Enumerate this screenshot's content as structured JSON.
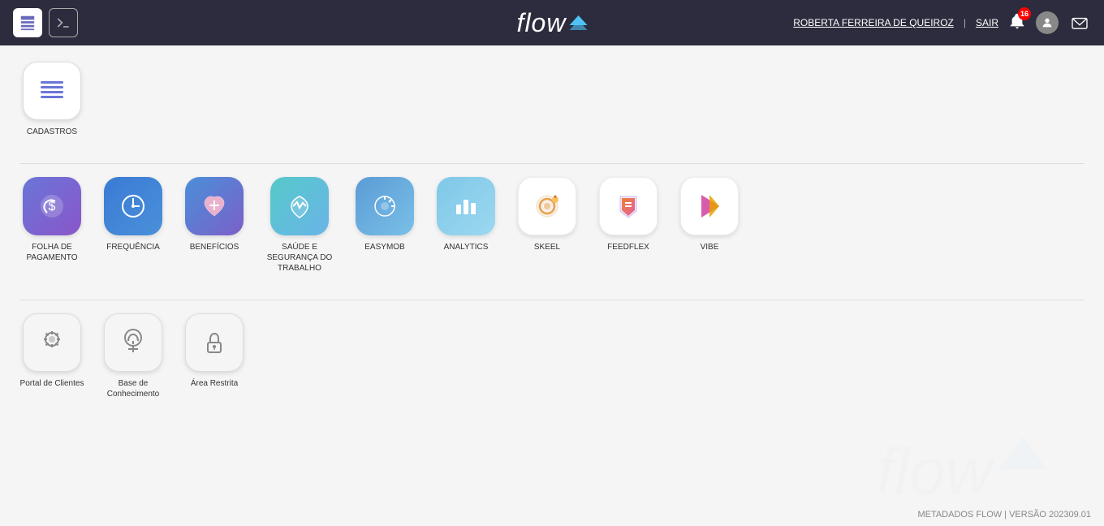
{
  "header": {
    "logo_text": "flow",
    "user_name": "ROBERTA FERREIRA DE QUEIROZ",
    "separator": "|",
    "sair_label": "SAIR",
    "bell_count": "16"
  },
  "sections": [
    {
      "id": "cadastros",
      "apps": [
        {
          "id": "cadastros",
          "label": "CADASTROS",
          "icon_type": "cadastros"
        }
      ]
    },
    {
      "id": "main-apps",
      "apps": [
        {
          "id": "folha",
          "label": "FOLHA DE PAGAMENTO",
          "icon_type": "folha"
        },
        {
          "id": "frequencia",
          "label": "FREQUÊNCIA",
          "icon_type": "frequencia"
        },
        {
          "id": "beneficios",
          "label": "BENEFÍCIOS",
          "icon_type": "beneficios"
        },
        {
          "id": "saude",
          "label": "SAÚDE E SEGURANÇA DO TRABALHO",
          "icon_type": "saude"
        },
        {
          "id": "easymob",
          "label": "EASYMOB",
          "icon_type": "easymob"
        },
        {
          "id": "analytics",
          "label": "ANALYTICS",
          "icon_type": "analytics"
        },
        {
          "id": "skeel",
          "label": "SKEEL",
          "icon_type": "skeel"
        },
        {
          "id": "feedflex",
          "label": "FEEDFLEX",
          "icon_type": "feedflex"
        },
        {
          "id": "vibe",
          "label": "VIBE",
          "icon_type": "vibe"
        }
      ]
    },
    {
      "id": "other-apps",
      "apps": [
        {
          "id": "portal",
          "label": "Portal de Clientes",
          "icon_type": "portal"
        },
        {
          "id": "base",
          "label": "Base de Conhecimento",
          "icon_type": "base"
        },
        {
          "id": "restrita",
          "label": "Área Restrita",
          "icon_type": "restrita"
        }
      ]
    }
  ],
  "footer": {
    "text": "METADADOS FLOW | VERSÃO 202309.01"
  }
}
